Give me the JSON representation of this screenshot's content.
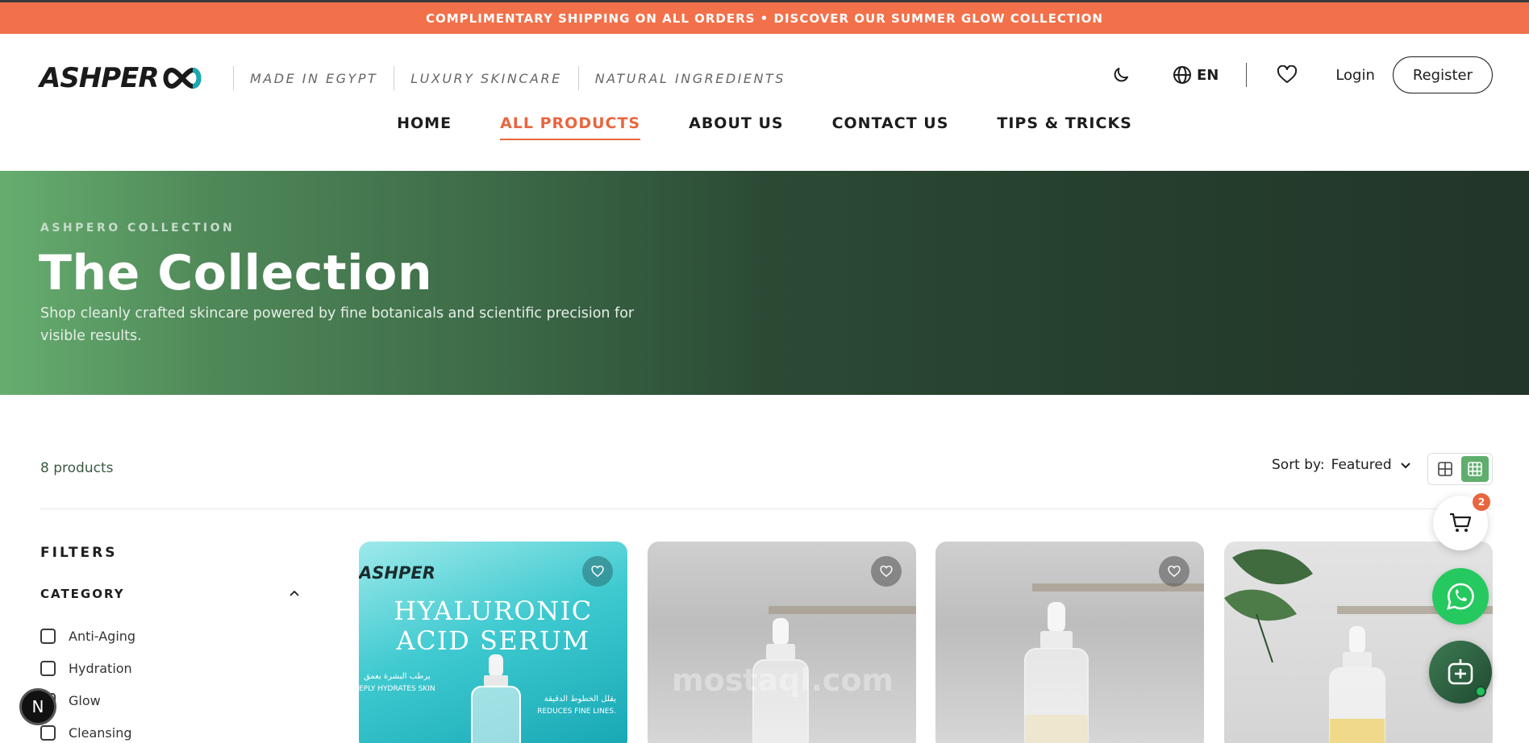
{
  "announcement": {
    "text": "COMPLIMENTARY SHIPPING ON ALL ORDERS • DISCOVER OUR SUMMER GLOW COLLECTION"
  },
  "brand": {
    "logo_text": "ASHPER"
  },
  "taglines": [
    "MADE IN EGYPT",
    "LUXURY SKINCARE",
    "NATURAL INGREDIENTS"
  ],
  "header": {
    "theme_icon": "moon-icon",
    "globe_icon": "globe-icon",
    "language": "EN",
    "wishlist_icon": "heart-icon",
    "login_label": "Login",
    "register_label": "Register"
  },
  "nav": {
    "items": [
      {
        "label": "HOME",
        "active": false
      },
      {
        "label": "ALL PRODUCTS",
        "active": true
      },
      {
        "label": "ABOUT US",
        "active": false
      },
      {
        "label": "CONTACT US",
        "active": false
      },
      {
        "label": "TIPS & TRICKS",
        "active": false
      }
    ]
  },
  "hero": {
    "kicker": "ASHPERO COLLECTION",
    "title": "The Collection",
    "subtitle": "Shop cleanly crafted skincare powered by fine botanicals and scientific precision for visible results."
  },
  "toolbar": {
    "count": "8 products",
    "sort_label": "Sort by:",
    "sort_value": "Featured",
    "view_modes": [
      "grid-2-icon",
      "grid-3-icon"
    ],
    "active_view": "grid-3-icon"
  },
  "filters": {
    "title": "FILTERS",
    "category_title": "CATEGORY",
    "categories": [
      "Anti-Aging",
      "Hydration",
      "Glow",
      "Cleansing"
    ]
  },
  "products": {
    "card1": {
      "brand": "ASHPER",
      "title_line1": "HYALURONIC",
      "title_line2": "ACID SERUM",
      "arabic_1": "يرطب البشرة بعمق",
      "english_1": "EPLY HYDRATES SKIN",
      "arabic_2": "يقلل الخطوط الدقيقة",
      "english_2": "REDUCES FINE LINES."
    },
    "card2": {
      "watermark": "mostaql.com"
    }
  },
  "floating": {
    "cart_count": "2",
    "n_label": "N"
  },
  "colors": {
    "accent": "#e8663f",
    "announcement_bg": "#f2714a",
    "hero_green": "#3d6b48",
    "whatsapp": "#25c95f"
  }
}
